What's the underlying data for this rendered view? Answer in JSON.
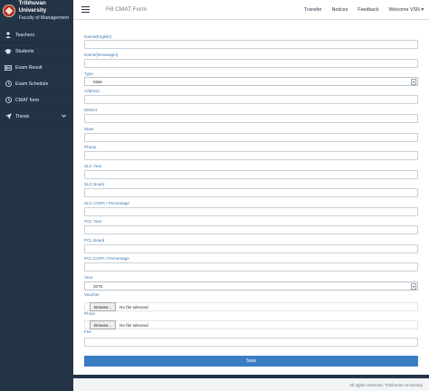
{
  "brand": {
    "title": "Tribhuvan University",
    "subtitle": "Faculty of Management"
  },
  "sidebar": {
    "items": [
      {
        "label": "Teachers",
        "icon": "user-icon"
      },
      {
        "label": "Students",
        "icon": "graduation-cap-icon"
      },
      {
        "label": "Exam Result",
        "icon": "id-card-icon"
      },
      {
        "label": "Exam Schedule",
        "icon": "clock-icon"
      },
      {
        "label": "CMAT form",
        "icon": "clock-icon"
      },
      {
        "label": "Thesis",
        "icon": "paper-plane-icon"
      }
    ]
  },
  "topbar": {
    "title": "Fill CMAT Form",
    "links": [
      "Transfer",
      "Notices",
      "Feedback",
      "Welcome VSN ▾"
    ]
  },
  "form": {
    "name_english": "Name(English)",
    "name_devanagiri": "Name(Devanagiri)",
    "type_label": "Type",
    "type_value": "Male",
    "address": "Address",
    "district": "District",
    "state": "State",
    "phone": "Phone",
    "slc_year": "SLC Year",
    "slc_board": "SLC Board",
    "slc_cgpa": "SLC CGPA / Percentage",
    "pcl_year": "PCL Year",
    "pcl_board": "PCL Board",
    "pcl_cgpa": "PCL CGPA / Percentage",
    "year_label": "Year",
    "year_value": "2075",
    "voucher": "Voucher",
    "photo": "Photo",
    "browse": "Browse...",
    "no_file": "No file selected.",
    "fee": "Fee",
    "save": "Save"
  },
  "footer": {
    "text": "All rights reserved. Tribhuvan University"
  }
}
